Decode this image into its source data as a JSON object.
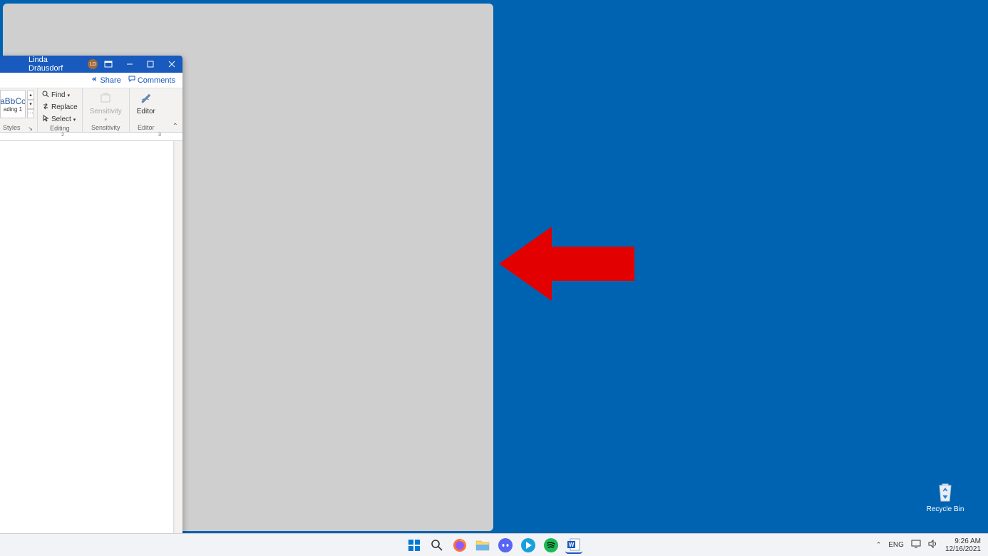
{
  "desktop": {
    "recycle_bin_label": "Recycle Bin"
  },
  "word": {
    "user_name": "Linda Dräusdorf",
    "user_initials": "LD",
    "share_label": "Share",
    "comments_label": "Comments",
    "ribbon": {
      "styles": {
        "sample_text": "aBbCc",
        "style_name": "ading 1",
        "group_label": "Styles"
      },
      "editing": {
        "find_label": "Find",
        "replace_label": "Replace",
        "select_label": "Select",
        "group_label": "Editing"
      },
      "sensitivity": {
        "button_label": "Sensitivity",
        "group_label": "Sensitivity"
      },
      "editor": {
        "button_label": "Editor",
        "group_label": "Editor"
      }
    },
    "ruler_marks": [
      "2",
      "3"
    ]
  },
  "taskbar": {
    "language": "ENG",
    "time": "9:26 AM",
    "date": "12/16/2021"
  }
}
